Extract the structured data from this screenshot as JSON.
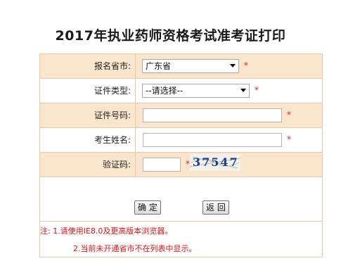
{
  "page_title": "2017年执业药师资格考试准考证打印",
  "form": {
    "province": {
      "label": "报名省市:",
      "selected": "广东省",
      "required_mark": "*"
    },
    "id_type": {
      "label": "证件类型:",
      "selected": "--请选择--",
      "required_mark": "*"
    },
    "id_number": {
      "label": "证件号码:",
      "value": "",
      "required_mark": "*"
    },
    "name": {
      "label": "考生姓名:",
      "value": "",
      "required_mark": "*"
    },
    "captcha": {
      "label": "验证码:",
      "value": "",
      "required_mark": "*",
      "image_text": "37547"
    }
  },
  "buttons": {
    "confirm_label": "确 定",
    "back_label": "返 回"
  },
  "notes": {
    "line1": "注: 1.请使用IE8.0及更高版本浏览器。",
    "line2": "2.当前未开通省市不在列表中显示。"
  },
  "colors": {
    "row_shade": "#fce5cd",
    "border": "#e8c9a6",
    "required": "#e21b1b",
    "note_text": "#d41616"
  }
}
